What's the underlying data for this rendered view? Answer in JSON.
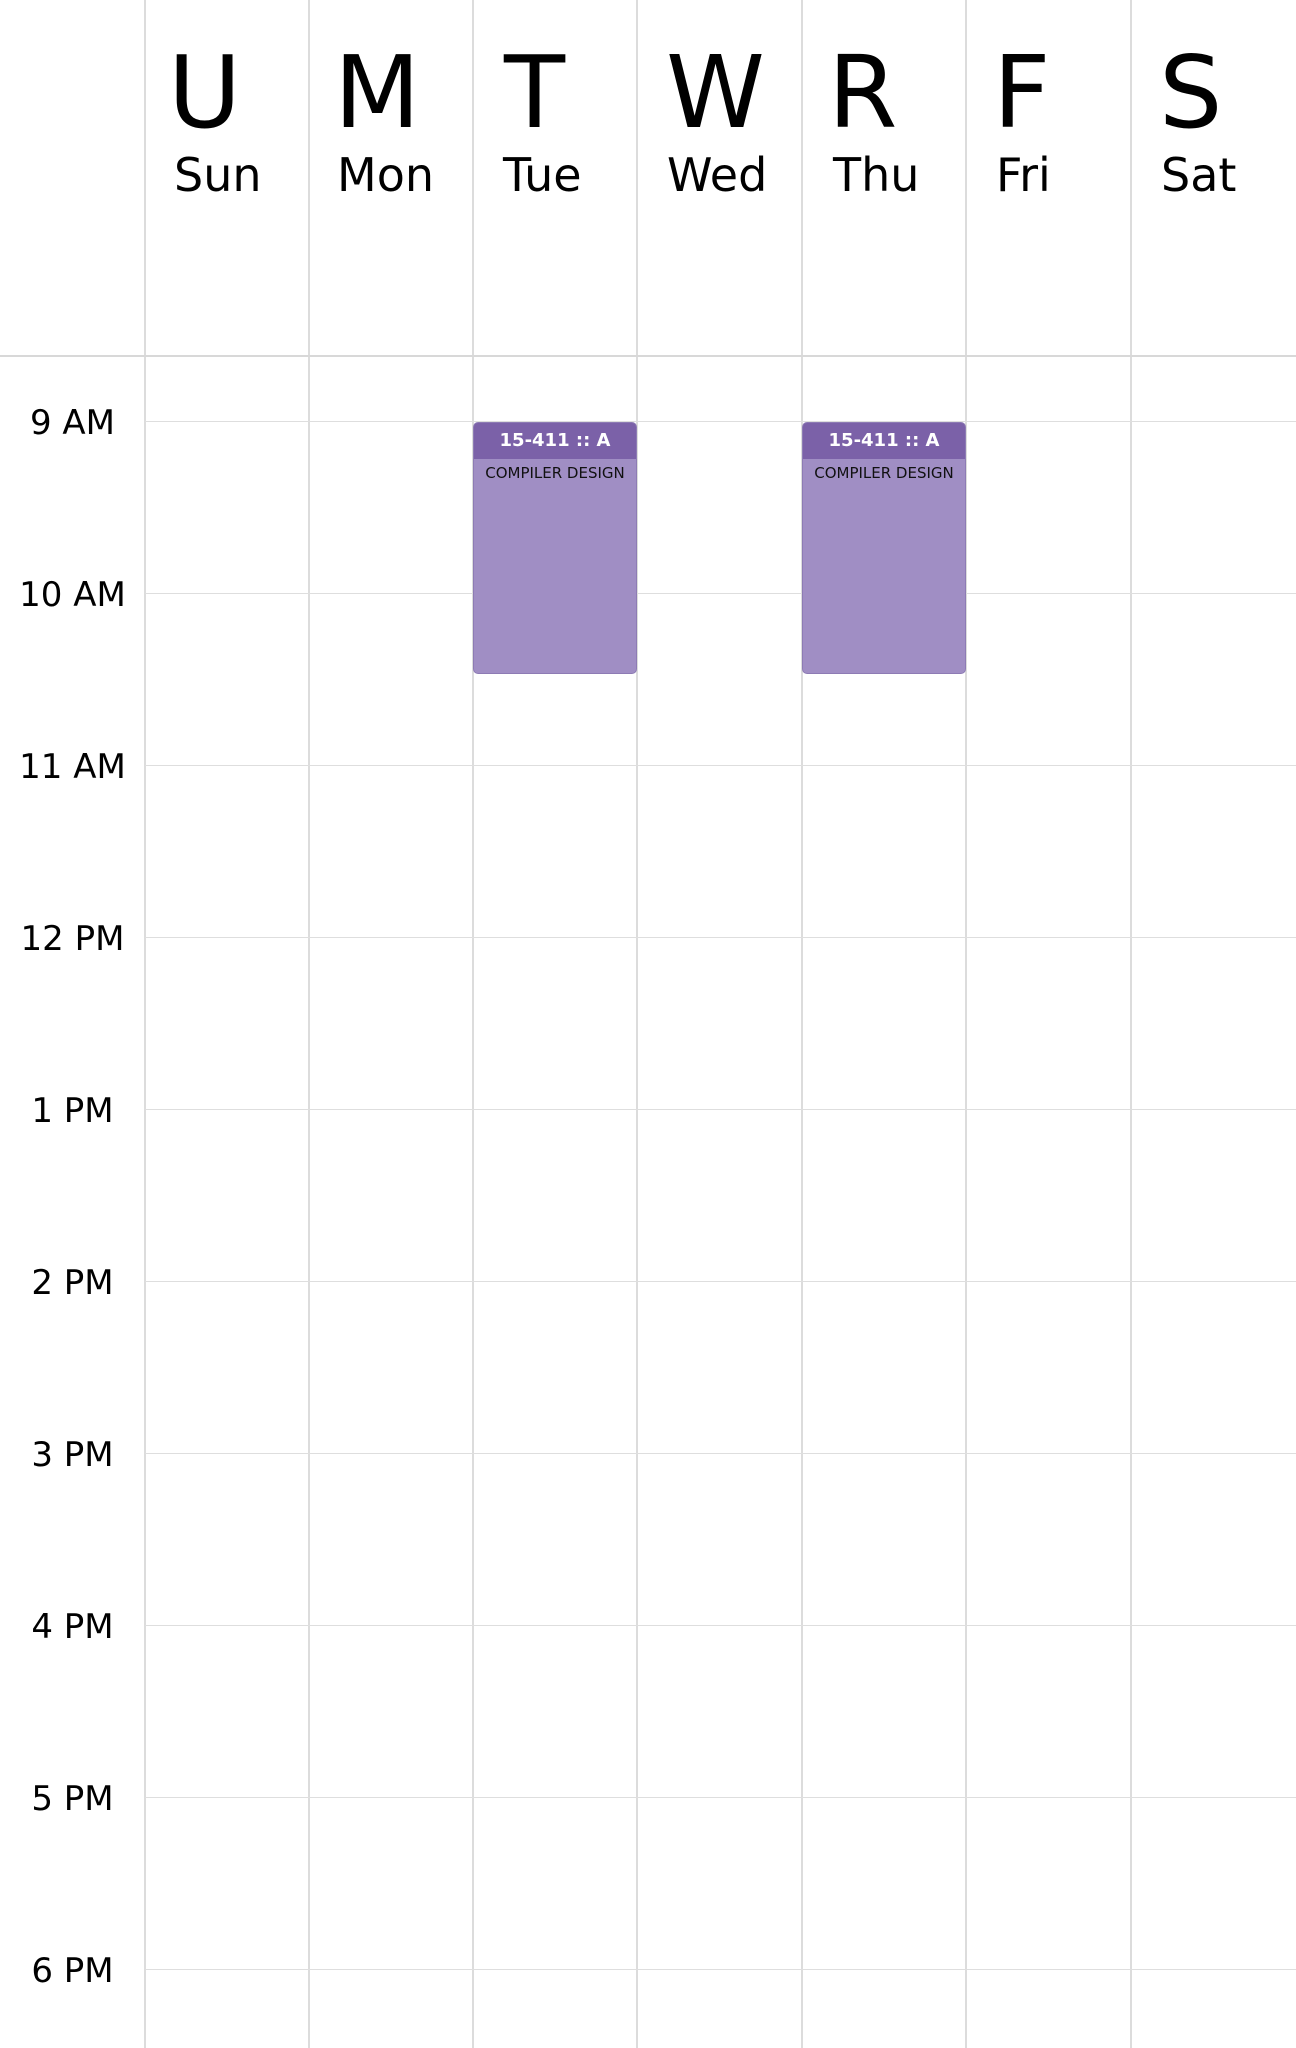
{
  "days": [
    {
      "letter": "U",
      "name": "Sun"
    },
    {
      "letter": "M",
      "name": "Mon"
    },
    {
      "letter": "T",
      "name": "Tue"
    },
    {
      "letter": "W",
      "name": "Wed"
    },
    {
      "letter": "R",
      "name": "Thu"
    },
    {
      "letter": "F",
      "name": "Fri"
    },
    {
      "letter": "S",
      "name": "Sat"
    }
  ],
  "times": [
    "9 AM",
    "10 AM",
    "11 AM",
    "12 PM",
    "1 PM",
    "2 PM",
    "3 PM",
    "4 PM",
    "5 PM",
    "6 PM"
  ],
  "events": [
    {
      "day": "Tue",
      "code": "15-411 :: A",
      "title": "COMPILER DESIGN",
      "start": "9 AM",
      "end": "10:30 AM"
    },
    {
      "day": "Thu",
      "code": "15-411 :: A",
      "title": "COMPILER DESIGN",
      "start": "9 AM",
      "end": "10:30 AM"
    }
  ],
  "colors": {
    "event_fill": "#a08ec4",
    "event_header": "#7b61a8",
    "grid": "#dcdcdc"
  }
}
